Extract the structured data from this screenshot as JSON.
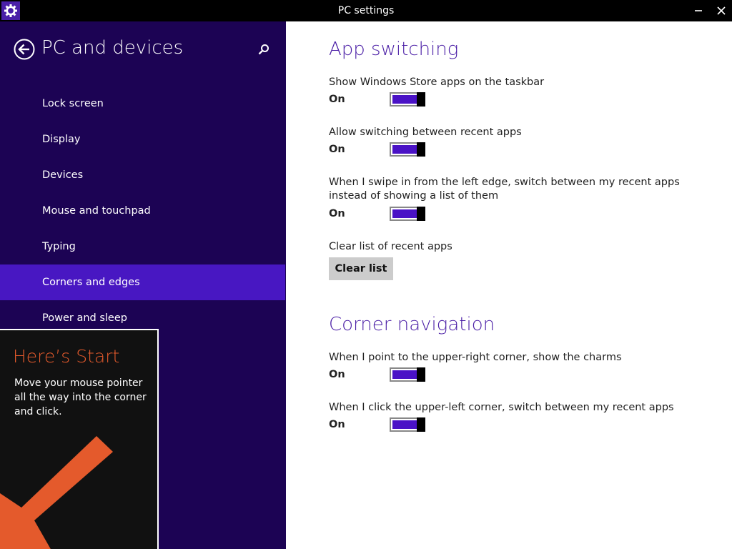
{
  "window": {
    "title": "PC settings"
  },
  "sidebar": {
    "title": "PC and devices",
    "items": [
      {
        "label": "Lock screen"
      },
      {
        "label": "Display"
      },
      {
        "label": "Devices"
      },
      {
        "label": "Mouse and touchpad"
      },
      {
        "label": "Typing"
      },
      {
        "label": "Corners and edges",
        "selected": true
      },
      {
        "label": "Power and sleep"
      }
    ]
  },
  "tip": {
    "title": "Here’s Start",
    "body": "Move your mouse pointer all the way into the corner and click."
  },
  "main": {
    "app_switching": {
      "heading": "App switching",
      "settings": [
        {
          "label": "Show Windows Store apps on the taskbar",
          "state": "On"
        },
        {
          "label": "Allow switching between recent apps",
          "state": "On"
        },
        {
          "label": "When I swipe in from the left edge, switch between my recent apps instead of showing a list of them",
          "state": "On"
        }
      ],
      "clear": {
        "label": "Clear list of recent apps",
        "button": "Clear list"
      }
    },
    "corner_navigation": {
      "heading": "Corner navigation",
      "settings": [
        {
          "label": "When I point to the upper-right corner, show the charms",
          "state": "On"
        },
        {
          "label": "When I click the upper-left corner, switch between my recent apps",
          "state": "On"
        }
      ]
    }
  },
  "icons": {
    "app": "gear-icon",
    "back": "back-arrow-icon",
    "search": "search-icon",
    "minimize": "minimize-icon",
    "close": "close-icon",
    "tip_arrow": "arrow-down-left-icon"
  },
  "colors": {
    "sidebar_bg": "#1c0354",
    "selected_bg": "#4817c2",
    "accent": "#4b1fa6",
    "toggle_fill": "#4a12c6",
    "tip_accent": "#e45a2c"
  }
}
